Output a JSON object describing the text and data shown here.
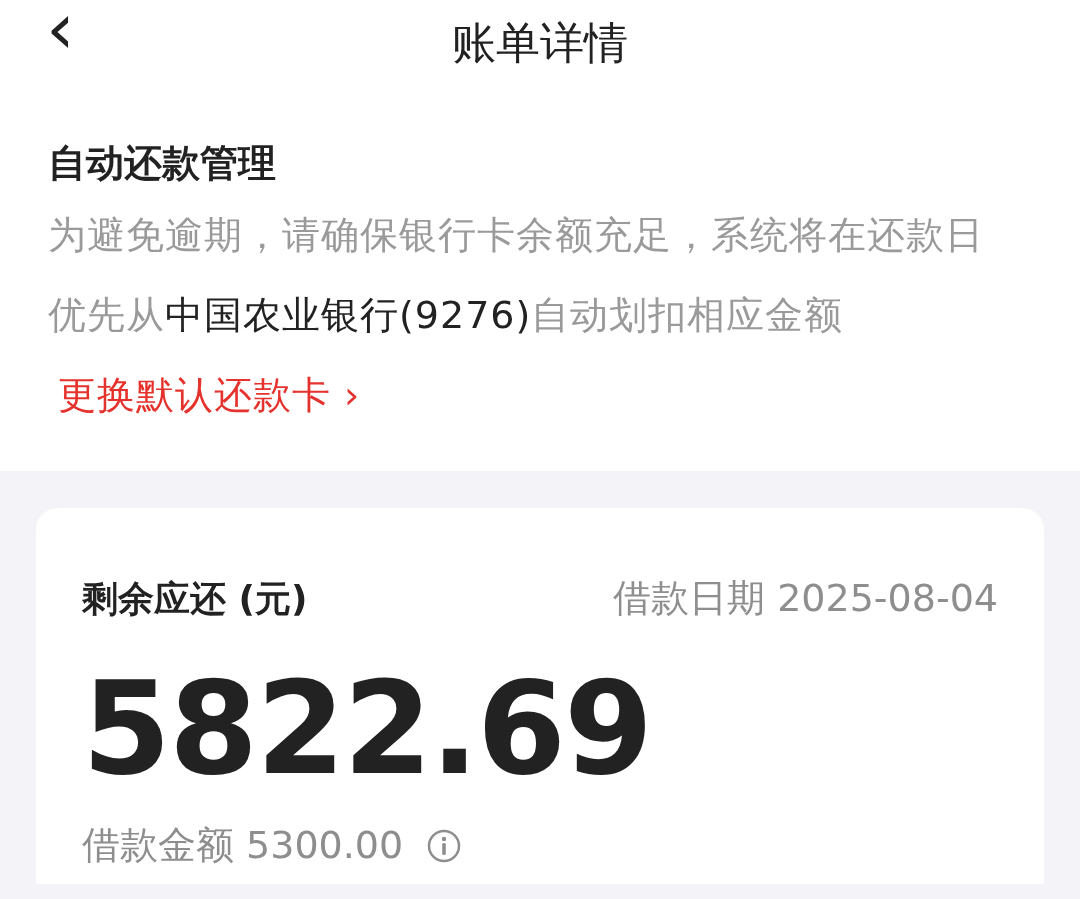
{
  "header": {
    "back_icon": "‹",
    "title": "账单详情"
  },
  "autopay": {
    "heading": "自动还款管理",
    "text_before": "为避免逾期，请确保银行卡余额充足，系统将在还款日优先从",
    "bank": "中国农业银行(9276)",
    "text_after": "自动划扣相应金额",
    "link": "更换默认还款卡",
    "link_arrow": "›"
  },
  "summary": {
    "label": "剩余应还 (元)",
    "date_label": "借款日期",
    "date": "2025-08-04",
    "amount": "5822.69",
    "loan_label": "借款金额",
    "loan_amount": "5300.00"
  }
}
